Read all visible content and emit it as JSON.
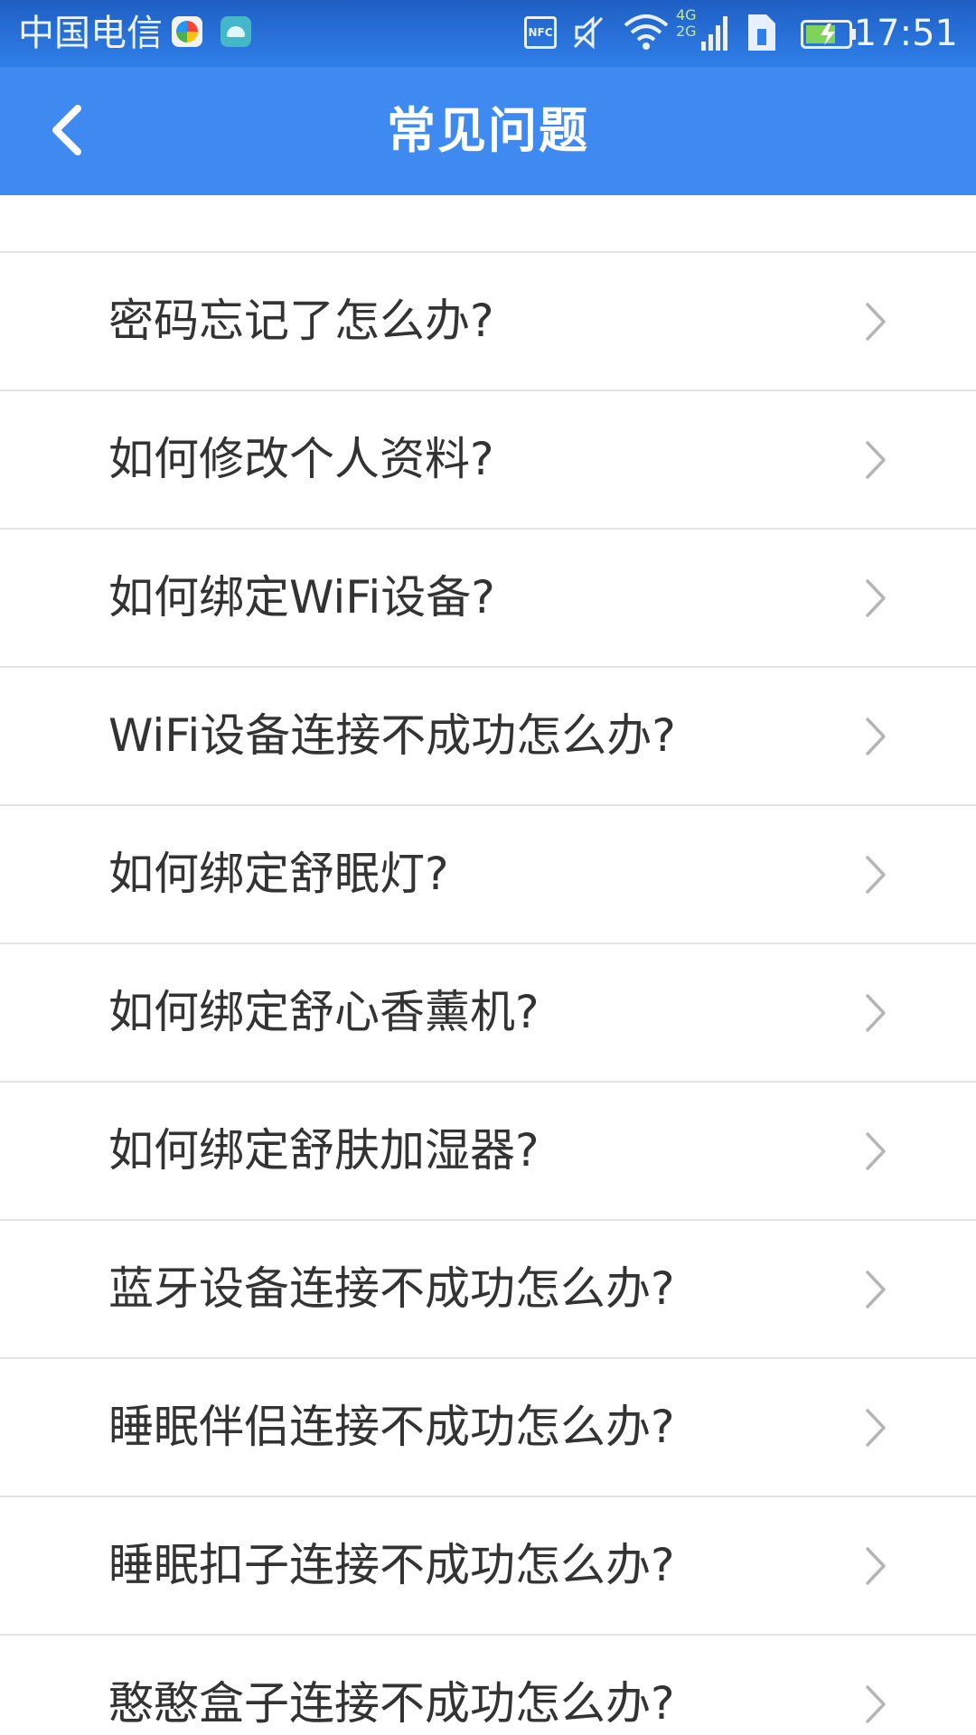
{
  "status_bar": {
    "carrier": "中国电信",
    "nfc_label": "NFC",
    "network_label_top": "4G",
    "network_label_bottom": "2G",
    "time": "17:51",
    "icons": [
      "app-notification-icon",
      "android-notification-icon",
      "nfc-icon",
      "vibrate-mute-icon",
      "wifi-icon",
      "signal-icon",
      "sim-icon",
      "battery-charging-icon"
    ]
  },
  "header": {
    "back_icon": "chevron-left-icon",
    "title": "常见问题",
    "background_color": "#3f8af0"
  },
  "faq": {
    "chevron_icon": "chevron-right-icon",
    "items": [
      {
        "label": "密码忘记了怎么办?"
      },
      {
        "label": "如何修改个人资料?"
      },
      {
        "label": "如何绑定WiFi设备?"
      },
      {
        "label": "WiFi设备连接不成功怎么办?"
      },
      {
        "label": "如何绑定舒眠灯?"
      },
      {
        "label": "如何绑定舒心香薰机?"
      },
      {
        "label": "如何绑定舒肤加湿器?"
      },
      {
        "label": "蓝牙设备连接不成功怎么办?"
      },
      {
        "label": "睡眠伴侣连接不成功怎么办?"
      },
      {
        "label": "睡眠扣子连接不成功怎么办?"
      },
      {
        "label": "憨憨盒子连接不成功怎么办?"
      }
    ]
  }
}
